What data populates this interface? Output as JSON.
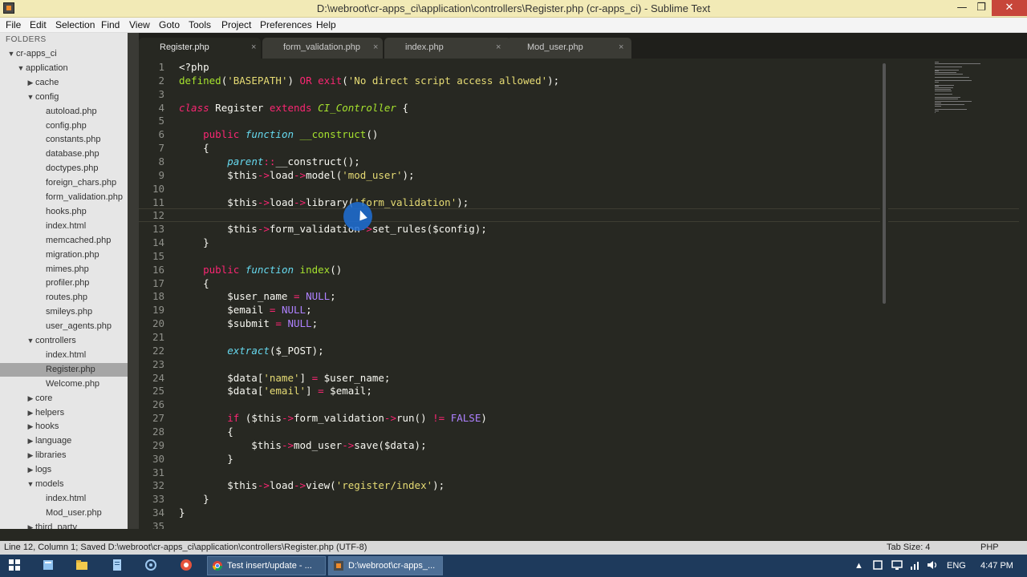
{
  "window": {
    "title": "D:\\webroot\\cr-apps_ci\\application\\controllers\\Register.php (cr-apps_ci) - Sublime Text",
    "minimize": "—",
    "maximize": "❐",
    "close": "✕"
  },
  "menu": [
    "File",
    "Edit",
    "Selection",
    "Find",
    "View",
    "Goto",
    "Tools",
    "Project",
    "Preferences",
    "Help"
  ],
  "sidebar": {
    "header": "FOLDERS",
    "items": [
      {
        "label": "cr-apps_ci",
        "depth": 1,
        "arrow": "▼"
      },
      {
        "label": "application",
        "depth": 2,
        "arrow": "▼"
      },
      {
        "label": "cache",
        "depth": 3,
        "arrow": "▶"
      },
      {
        "label": "config",
        "depth": 3,
        "arrow": "▼"
      },
      {
        "label": "autoload.php",
        "depth": 4,
        "arrow": ""
      },
      {
        "label": "config.php",
        "depth": 4,
        "arrow": ""
      },
      {
        "label": "constants.php",
        "depth": 4,
        "arrow": ""
      },
      {
        "label": "database.php",
        "depth": 4,
        "arrow": ""
      },
      {
        "label": "doctypes.php",
        "depth": 4,
        "arrow": ""
      },
      {
        "label": "foreign_chars.php",
        "depth": 4,
        "arrow": ""
      },
      {
        "label": "form_validation.php",
        "depth": 4,
        "arrow": ""
      },
      {
        "label": "hooks.php",
        "depth": 4,
        "arrow": ""
      },
      {
        "label": "index.html",
        "depth": 4,
        "arrow": ""
      },
      {
        "label": "memcached.php",
        "depth": 4,
        "arrow": ""
      },
      {
        "label": "migration.php",
        "depth": 4,
        "arrow": ""
      },
      {
        "label": "mimes.php",
        "depth": 4,
        "arrow": ""
      },
      {
        "label": "profiler.php",
        "depth": 4,
        "arrow": ""
      },
      {
        "label": "routes.php",
        "depth": 4,
        "arrow": ""
      },
      {
        "label": "smileys.php",
        "depth": 4,
        "arrow": ""
      },
      {
        "label": "user_agents.php",
        "depth": 4,
        "arrow": ""
      },
      {
        "label": "controllers",
        "depth": 3,
        "arrow": "▼"
      },
      {
        "label": "index.html",
        "depth": 4,
        "arrow": ""
      },
      {
        "label": "Register.php",
        "depth": 4,
        "arrow": "",
        "selected": true
      },
      {
        "label": "Welcome.php",
        "depth": 4,
        "arrow": ""
      },
      {
        "label": "core",
        "depth": 3,
        "arrow": "▶"
      },
      {
        "label": "helpers",
        "depth": 3,
        "arrow": "▶"
      },
      {
        "label": "hooks",
        "depth": 3,
        "arrow": "▶"
      },
      {
        "label": "language",
        "depth": 3,
        "arrow": "▶"
      },
      {
        "label": "libraries",
        "depth": 3,
        "arrow": "▶"
      },
      {
        "label": "logs",
        "depth": 3,
        "arrow": "▶"
      },
      {
        "label": "models",
        "depth": 3,
        "arrow": "▼"
      },
      {
        "label": "index.html",
        "depth": 4,
        "arrow": ""
      },
      {
        "label": "Mod_user.php",
        "depth": 4,
        "arrow": ""
      },
      {
        "label": "third_party",
        "depth": 3,
        "arrow": "▶"
      }
    ]
  },
  "tabs": [
    {
      "label": "Register.php",
      "close": "×",
      "active": true
    },
    {
      "label": "form_validation.php",
      "close": "×",
      "active": false
    },
    {
      "label": "index.php",
      "close": "×",
      "active": false
    },
    {
      "label": "Mod_user.php",
      "close": "×",
      "active": false
    }
  ],
  "code": [
    [
      [
        "<?php",
        ""
      ]
    ],
    [
      [
        "defined",
        "fn"
      ],
      [
        "(",
        ""
      ],
      [
        "'BASEPATH'",
        "str"
      ],
      [
        ") ",
        ""
      ],
      [
        "OR",
        "kw"
      ],
      [
        " ",
        ""
      ],
      [
        "exit",
        "kw"
      ],
      [
        "(",
        ""
      ],
      [
        "'No direct script access allowed'",
        "str"
      ],
      [
        ");",
        ""
      ]
    ],
    [],
    [
      [
        "class",
        "st"
      ],
      [
        " Register ",
        ""
      ],
      [
        "extends",
        "kw"
      ],
      [
        " ",
        ""
      ],
      [
        "CI_Controller",
        "cls"
      ],
      [
        " {",
        ""
      ]
    ],
    [],
    [
      [
        "    ",
        ""
      ],
      [
        "public",
        "kw"
      ],
      [
        " ",
        ""
      ],
      [
        "function",
        "it"
      ],
      [
        " ",
        ""
      ],
      [
        "__construct",
        "fn"
      ],
      [
        "()",
        ""
      ]
    ],
    [
      [
        "    {",
        ""
      ]
    ],
    [
      [
        "        ",
        ""
      ],
      [
        "parent",
        "it"
      ],
      [
        "::",
        "arr"
      ],
      [
        "__construct();",
        ""
      ]
    ],
    [
      [
        "        $this",
        ""
      ],
      [
        "->",
        "arr"
      ],
      [
        "load",
        ""
      ],
      [
        "->",
        "arr"
      ],
      [
        "model(",
        ""
      ],
      [
        "'mod_user'",
        "str"
      ],
      [
        ");",
        ""
      ]
    ],
    [],
    [
      [
        "        $this",
        ""
      ],
      [
        "->",
        "arr"
      ],
      [
        "load",
        ""
      ],
      [
        "->",
        "arr"
      ],
      [
        "library(",
        ""
      ],
      [
        "'form_validation'",
        "str"
      ],
      [
        ");",
        ""
      ]
    ],
    [],
    [
      [
        "        $this",
        ""
      ],
      [
        "->",
        "arr"
      ],
      [
        "form_validation",
        ""
      ],
      [
        "->",
        "arr"
      ],
      [
        "set_rules($config);",
        ""
      ]
    ],
    [
      [
        "    }",
        ""
      ]
    ],
    [],
    [
      [
        "    ",
        ""
      ],
      [
        "public",
        "kw"
      ],
      [
        " ",
        ""
      ],
      [
        "function",
        "it"
      ],
      [
        " ",
        ""
      ],
      [
        "index",
        "fn"
      ],
      [
        "()",
        ""
      ]
    ],
    [
      [
        "    {",
        ""
      ]
    ],
    [
      [
        "        $user_name ",
        ""
      ],
      [
        "=",
        "arr"
      ],
      [
        " ",
        ""
      ],
      [
        "NULL",
        "cst"
      ],
      [
        ";",
        ""
      ]
    ],
    [
      [
        "        $email ",
        ""
      ],
      [
        "=",
        "arr"
      ],
      [
        " ",
        ""
      ],
      [
        "NULL",
        "cst"
      ],
      [
        ";",
        ""
      ]
    ],
    [
      [
        "        $submit ",
        ""
      ],
      [
        "=",
        "arr"
      ],
      [
        " ",
        ""
      ],
      [
        "NULL",
        "cst"
      ],
      [
        ";",
        ""
      ]
    ],
    [],
    [
      [
        "        ",
        ""
      ],
      [
        "extract",
        "it"
      ],
      [
        "($_POST);",
        ""
      ]
    ],
    [],
    [
      [
        "        $data[",
        ""
      ],
      [
        "'name'",
        "str"
      ],
      [
        "] ",
        ""
      ],
      [
        "=",
        "arr"
      ],
      [
        " $user_name;",
        ""
      ]
    ],
    [
      [
        "        $data[",
        ""
      ],
      [
        "'email'",
        "str"
      ],
      [
        "] ",
        ""
      ],
      [
        "=",
        "arr"
      ],
      [
        " $email;",
        ""
      ]
    ],
    [],
    [
      [
        "        ",
        ""
      ],
      [
        "if",
        "kw"
      ],
      [
        " ($this",
        ""
      ],
      [
        "->",
        "arr"
      ],
      [
        "form_validation",
        ""
      ],
      [
        "->",
        "arr"
      ],
      [
        "run() ",
        ""
      ],
      [
        "!=",
        "arr"
      ],
      [
        " ",
        ""
      ],
      [
        "FALSE",
        "cst"
      ],
      [
        ")",
        ""
      ]
    ],
    [
      [
        "        {",
        ""
      ]
    ],
    [
      [
        "            $this",
        ""
      ],
      [
        "->",
        "arr"
      ],
      [
        "mod_user",
        ""
      ],
      [
        "->",
        "arr"
      ],
      [
        "save($data);",
        ""
      ]
    ],
    [
      [
        "        }",
        ""
      ]
    ],
    [],
    [
      [
        "        $this",
        ""
      ],
      [
        "->",
        "arr"
      ],
      [
        "load",
        ""
      ],
      [
        "->",
        "arr"
      ],
      [
        "view(",
        ""
      ],
      [
        "'register/index'",
        "str"
      ],
      [
        ");",
        ""
      ]
    ],
    [
      [
        "    }",
        ""
      ]
    ],
    [
      [
        "}",
        ""
      ]
    ],
    []
  ],
  "current_line": 12,
  "status": {
    "left": "Line 12, Column 1; Saved D:\\webroot\\cr-apps_ci\\application\\controllers\\Register.php (UTF-8)",
    "tab_size": "Tab Size: 4",
    "syntax": "PHP"
  },
  "taskbar": {
    "tasks": [
      {
        "label": "Test insert/update - ..."
      },
      {
        "label": "D:\\webroot\\cr-apps_..."
      }
    ],
    "language": "ENG",
    "time": "4:47 PM"
  },
  "colors": {
    "editor_bg": "#272822",
    "keyword": "#f92672",
    "string": "#e6db74",
    "function": "#a6e22e",
    "constant": "#ae81ff",
    "storage_italic": "#66d9ef"
  }
}
